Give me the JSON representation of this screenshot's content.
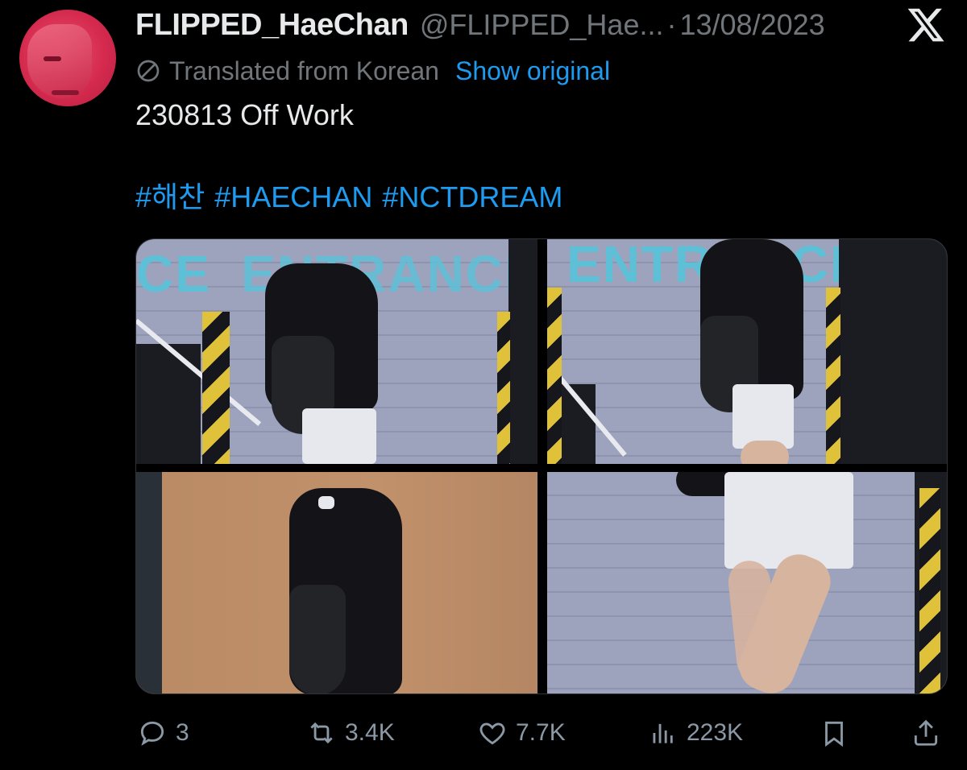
{
  "tweet": {
    "author_name": "FLIPPED_HaeChan",
    "handle": "@FLIPPED_Hae...",
    "separator": "·",
    "date": "13/08/2023",
    "translated_label": "Translated from Korean",
    "show_original_label": "Show original",
    "text": "230813 Off Work",
    "hashtags": [
      "#해찬",
      "#HAECHAN",
      "#NCTDREAM"
    ]
  },
  "media": {
    "photo_count": 4,
    "sign_texts": [
      "CE",
      "ENTRANCE",
      "ENTRANCE"
    ]
  },
  "actions": {
    "reply_count": "3",
    "retweet_count": "3.4K",
    "like_count": "7.7K",
    "views_count": "223K"
  },
  "icons": {
    "reply": "reply-bubble-icon",
    "retweet": "retweet-icon",
    "like": "heart-icon",
    "views": "views-chart-icon",
    "bookmark": "bookmark-icon",
    "share": "share-icon",
    "translate": "globe-icon",
    "brand": "x-logo-icon"
  },
  "colors": {
    "background": "#000000",
    "primary_text": "#e7e9ea",
    "secondary_text": "#71767b",
    "link": "#1d9bf0",
    "action_gray": "#8b98a5"
  }
}
